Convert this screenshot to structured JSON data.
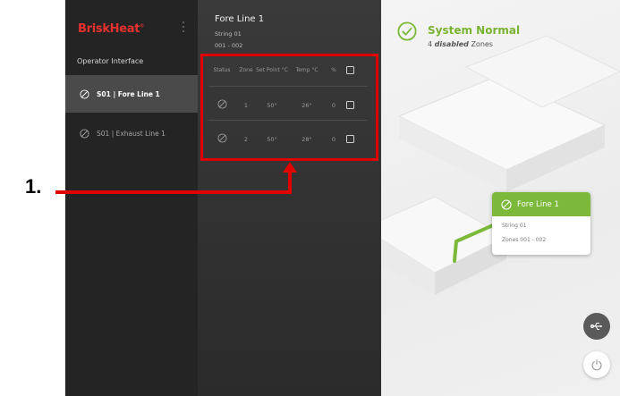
{
  "sidebar": {
    "brand": "BriskHeat",
    "brand_mark": "®",
    "section_label": "Operator Interface",
    "items": [
      {
        "label": "S01 | Fore Line 1",
        "active": true
      },
      {
        "label": "S01 | Exhaust Line 1",
        "active": false
      }
    ]
  },
  "panel": {
    "title": "Fore Line 1",
    "string": "String 01",
    "zone_range": "001 - 002",
    "columns": [
      "Status",
      "Zone",
      "Set Point °C",
      "Temp °C",
      "%"
    ],
    "rows": [
      {
        "zone": "1",
        "set_point": "50°",
        "temp": "26°",
        "percent": "0"
      },
      {
        "zone": "2",
        "set_point": "50°",
        "temp": "28°",
        "percent": "0"
      }
    ]
  },
  "system": {
    "title": "System Normal",
    "disabled_count": "4",
    "disabled_word": "disabled",
    "disabled_suffix": "Zones"
  },
  "card": {
    "title": "Fore Line 1",
    "line1": "String 01",
    "line2": "Zones 001 - 002"
  },
  "annotation": {
    "number": "1."
  },
  "colors": {
    "brand_red": "#e8312f",
    "accent_green": "#7cb83a",
    "annotation_red": "#e00000",
    "sidebar_bg": "#242424",
    "panel_bg": "#333333"
  },
  "icons": {
    "zone_status": "disabled-circle-slash-icon",
    "system_status": "check-circle-icon",
    "usb": "usb-icon",
    "power": "power-icon"
  }
}
